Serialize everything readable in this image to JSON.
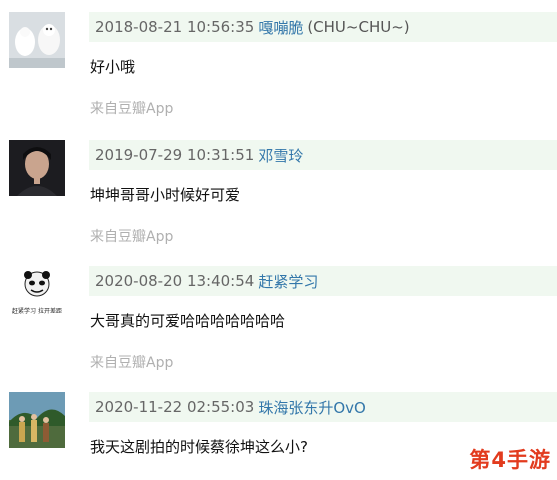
{
  "comments": [
    {
      "time": "2018-08-21 10:56:35",
      "user": "嘎嘣脆",
      "extra": "(CHU~CHU~)",
      "content": "好小哦",
      "source": "来自豆瓣App",
      "avatar": "white-cat-avatar"
    },
    {
      "time": "2019-07-29 10:31:51",
      "user": "邓雪玲",
      "extra": "",
      "content": "坤坤哥哥小时候好可爱",
      "source": "来自豆瓣App",
      "avatar": "portrait-dark-avatar"
    },
    {
      "time": "2020-08-20 13:40:54",
      "user": "赶紧学习",
      "extra": "",
      "content": "大哥真的可爱哈哈哈哈哈哈哈",
      "source": "来自豆瓣App",
      "avatar": "panda-meme-avatar",
      "avatar_caption": "赶紧学习 拉开差距"
    },
    {
      "time": "2020-11-22 02:55:03",
      "user": "珠海张东升OvO",
      "extra": "",
      "content": "我天这剧拍的时候蔡徐坤这么小?",
      "source": "",
      "avatar": "outdoor-scene-avatar"
    }
  ],
  "watermark": "第4手游"
}
